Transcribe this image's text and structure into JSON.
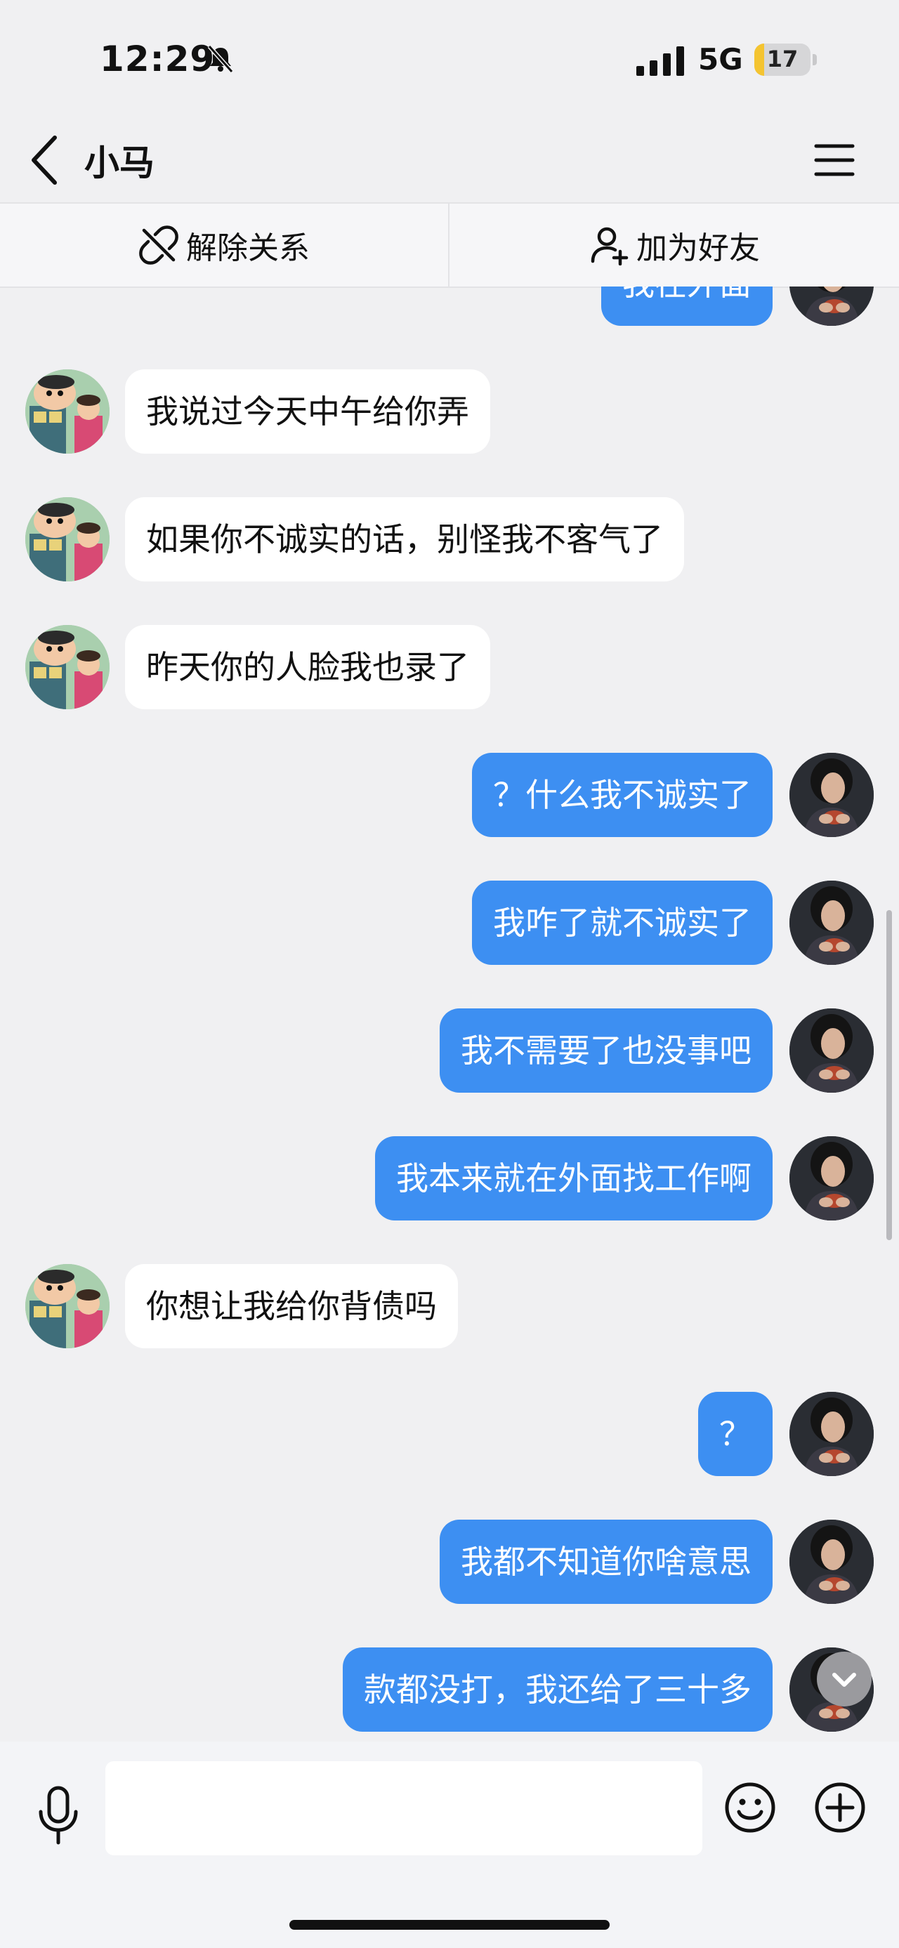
{
  "status_bar": {
    "time": "12:29",
    "network": "5G",
    "battery": "17",
    "battery_level_percent": 17
  },
  "header": {
    "title": "小马"
  },
  "actions": {
    "remove_relation": "解除关系",
    "add_friend": "加为好友"
  },
  "messages": [
    {
      "side": "me",
      "text": "我在外面"
    },
    {
      "side": "other",
      "text": "我说过今天中午给你弄"
    },
    {
      "side": "other",
      "text": "如果你不诚实的话，别怪我不客气了"
    },
    {
      "side": "other",
      "text": "昨天你的人脸我也录了"
    },
    {
      "side": "me",
      "text": "？什么我不诚实了"
    },
    {
      "side": "me",
      "text": "我咋了就不诚实了"
    },
    {
      "side": "me",
      "text": "我不需要了也没事吧"
    },
    {
      "side": "me",
      "text": "我本来就在外面找工作啊"
    },
    {
      "side": "other",
      "text": "你想让我给你背债吗"
    },
    {
      "side": "me",
      "text": "？"
    },
    {
      "side": "me",
      "text": "我都不知道你啥意思"
    },
    {
      "side": "me",
      "text": "款都没打，我还给了三十多"
    }
  ],
  "input": {
    "value": "",
    "placeholder": ""
  },
  "colors": {
    "my_bubble": "#3d8ff2",
    "their_bubble": "#ffffff",
    "background": "#f0f0f2",
    "battery": "#f4c431"
  }
}
